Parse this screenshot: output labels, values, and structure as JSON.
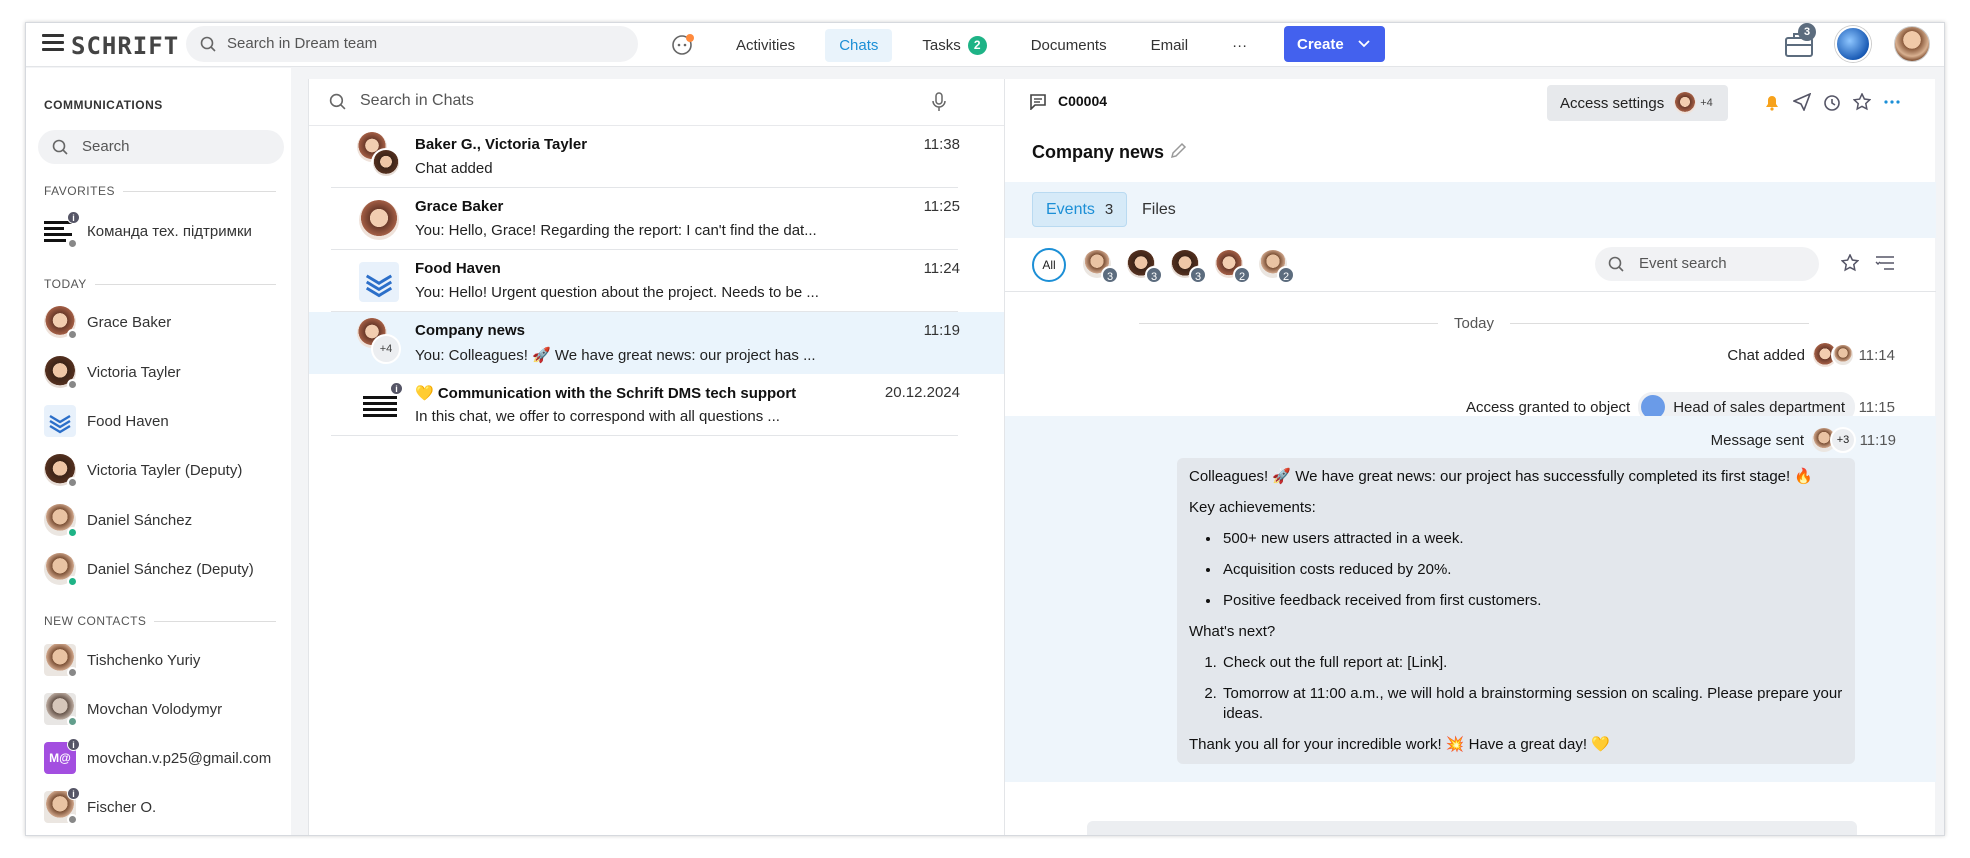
{
  "app": {
    "logo": "SCHRIFT"
  },
  "topbar": {
    "search_placeholder": "Search in Dream team",
    "nav": [
      {
        "label": "Activities",
        "active": false
      },
      {
        "label": "Chats",
        "active": true
      },
      {
        "label": "Tasks",
        "active": false,
        "badge": "2"
      },
      {
        "label": "Documents",
        "active": false
      },
      {
        "label": "Email",
        "active": false
      }
    ],
    "more": "···",
    "create_label": "Create",
    "cart_badge": "3"
  },
  "sidebar": {
    "title": "COMMUNICATIONS",
    "search_placeholder": "Search",
    "favorites_label": "FAVORITES",
    "favorites": [
      {
        "label": "Команда тех. підтримки"
      }
    ],
    "today_label": "TODAY",
    "today": [
      {
        "label": "Grace Baker",
        "status": "offline"
      },
      {
        "label": "Victoria Tayler",
        "status": "offline"
      },
      {
        "label": "Food Haven",
        "status": "none"
      },
      {
        "label": "Victoria Tayler (Deputy)",
        "status": "offline"
      },
      {
        "label": "Daniel Sánchez",
        "status": "online"
      },
      {
        "label": "Daniel Sánchez (Deputy)",
        "status": "online"
      }
    ],
    "new_contacts_label": "NEW CONTACTS",
    "new_contacts": [
      {
        "label": "Tishchenko Yuriy",
        "status": "offline"
      },
      {
        "label": "Movchan Volodymyr",
        "status": "online"
      },
      {
        "label": "movchan.v.p25@gmail.com",
        "avatar_text": "M@"
      },
      {
        "label": "Fischer O.",
        "status": "offline"
      }
    ]
  },
  "chatlist": {
    "search_placeholder": "Search in Chats",
    "chats": [
      {
        "name": "Baker G., Victoria Tayler",
        "message": "Chat added",
        "time": "11:38"
      },
      {
        "name": "Grace Baker",
        "message": "You: Hello, Grace! Regarding the report: I can't find the dat...",
        "time": "11:25"
      },
      {
        "name": "Food Haven",
        "message": "You: Hello! Urgent question about the project. Needs to be ...",
        "time": "11:24"
      },
      {
        "name": "Company news",
        "message": "You: Colleagues! 🚀 We have great news: our project has ...",
        "time": "11:19",
        "selected": true,
        "extra": "+4"
      },
      {
        "name": "💛 Communication with the Schrift DMS tech support",
        "message": "In this chat, we offer to correspond with all questions ...",
        "time": "20.12.2024"
      }
    ]
  },
  "pane": {
    "code": "C00004",
    "access_label": "Access settings",
    "access_extra": "+4",
    "title": "Company news",
    "tabs": [
      {
        "label": "Events",
        "count": "3",
        "active": true
      },
      {
        "label": "Files",
        "active": false
      }
    ],
    "all_label": "All",
    "filter_counts": [
      "3",
      "3",
      "3",
      "2",
      "2"
    ],
    "event_search_placeholder": "Event search",
    "today_label": "Today",
    "events": [
      {
        "text": "Chat added",
        "time": "11:14"
      },
      {
        "text": "Access granted to object",
        "chip": "Head of sales department",
        "time": "11:15"
      },
      {
        "text": "Message sent",
        "extra": "+3",
        "time": "11:19"
      }
    ],
    "message": {
      "intro": "Colleagues! 🚀 We have great news: our project has successfully completed its first stage! 🔥",
      "achievements_title": "Key achievements:",
      "achievements": [
        "500+ new users attracted in a week.",
        "Acquisition costs reduced by 20%.",
        "Positive feedback received from first customers."
      ],
      "next_title": "What's next?",
      "next": [
        "Check out the full report at: [Link].",
        "Tomorrow at 11:00 a.m., we will hold a brainstorming session on scaling. Please prepare your ideas."
      ],
      "outro": "Thank you all for your incredible work! 💥 Have a great day! 💛"
    }
  },
  "colors": {
    "accent": "#4361ee",
    "link": "#1c8fd6",
    "online": "#1eb386",
    "selected_bg": "#eaf4fc"
  }
}
